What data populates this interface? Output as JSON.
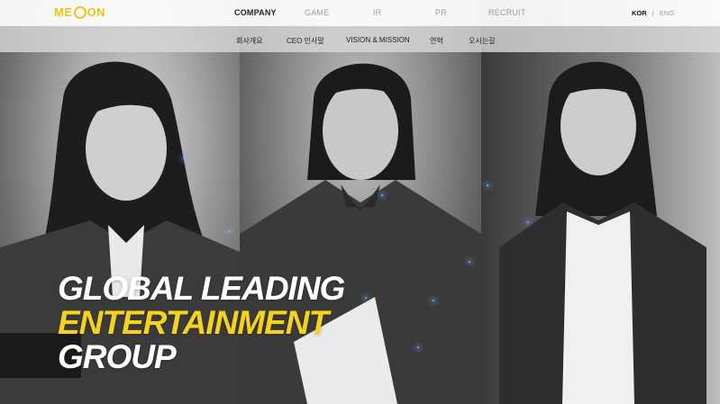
{
  "brand": {
    "logo_text": "MEZON",
    "accent": "#f1c40f"
  },
  "nav": {
    "items": [
      {
        "label": "COMPANY",
        "active": true
      },
      {
        "label": "GAME",
        "active": false
      },
      {
        "label": "IR",
        "active": false
      },
      {
        "label": "PR",
        "active": false
      },
      {
        "label": "RECRUIT",
        "active": false
      }
    ],
    "lang": {
      "kor": "KOR",
      "sep": "|",
      "eng": "ENG"
    }
  },
  "subnav": {
    "items": [
      "회사개요",
      "CEO 인사말",
      "VISION & MISSION",
      "연혁",
      "오시는길"
    ]
  },
  "hero": {
    "line1": "GLOBAL LEADING",
    "line2": "ENTERTAINMENT",
    "line3": "GROUP"
  }
}
